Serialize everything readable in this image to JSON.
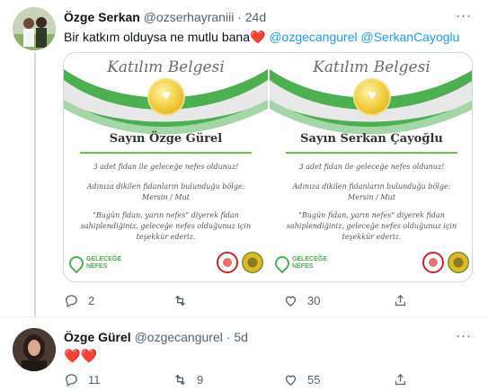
{
  "tweets": [
    {
      "author_name": "Özge Serkan",
      "handle": "@ozserhayraniii",
      "separator": "·",
      "time_ago": "24d",
      "text": "Bir katkım olduysa ne mutlu bana",
      "heart": "❤️",
      "mentions": [
        "@ozgecangurel",
        "@SerkanCayoglu"
      ],
      "more": "···",
      "replies": "2",
      "retweets": "",
      "likes": "30",
      "media": {
        "certificates": [
          {
            "title": "Katılım Belgesi",
            "recipient": "Sayın Özge Gürel",
            "line1": "3 adet fidan ile geleceğe nefes oldunuz!",
            "line2": "Adınıza dikilen fidanların bulunduğu bölge:",
            "line3": "Mersin / Mut",
            "line4": "\"Bugün fidan, yarın nefes\" diyerek fidan",
            "line5": "sahiplendiğiniz, geleceğe nefes olduğunuz için",
            "line6": "teşekkür ederiz.",
            "logo_line1": "GELECEĞE",
            "logo_line2": "NEFES"
          },
          {
            "title": "Katılım Belgesi",
            "recipient": "Sayın Serkan Çayoğlu",
            "line1": "3 adet fidan ile geleceğe nefes oldunuz!",
            "line2": "Adınıza dikilen fidanların bulunduğu bölge:",
            "line3": "Mersin / Mut",
            "line4": "\"Bugün fidan, yarın nefes\" diyerek fidan",
            "line5": "sahiplendiğiniz, geleceğe nefes olduğunuz için",
            "line6": "teşekkür ederiz.",
            "logo_line1": "GELECEĞE",
            "logo_line2": "NEFES"
          }
        ]
      }
    },
    {
      "author_name": "Özge Gürel",
      "handle": "@ozgecangurel",
      "separator": "·",
      "time_ago": "5d",
      "text": "❤️❤️",
      "more": "···",
      "replies": "11",
      "retweets": "9",
      "likes": "55"
    }
  ],
  "colors": {
    "accent": "#1d9bf0",
    "heart": "#e0245e",
    "muted": "#536471",
    "certificate_green": "#4caf50"
  },
  "icons": [
    "reply-icon",
    "retweet-icon",
    "like-icon",
    "share-icon",
    "more-icon",
    "seal-icon"
  ]
}
